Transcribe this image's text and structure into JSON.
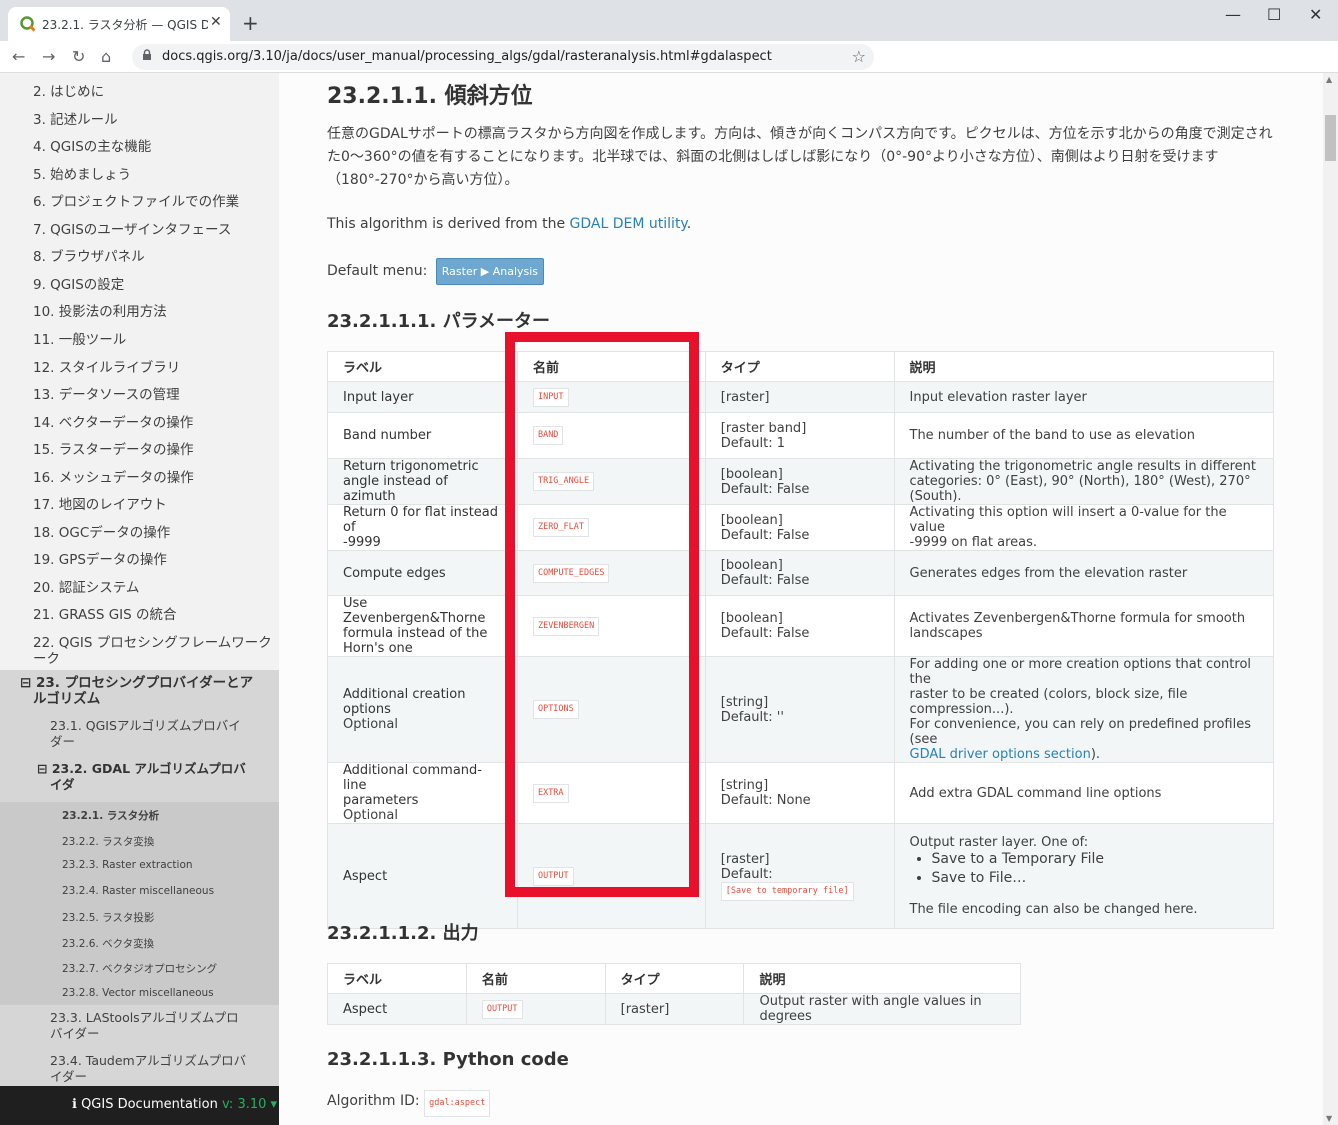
{
  "browser": {
    "tab_title": "23.2.1. ラスタ分析 — QGIS Docum",
    "url": "docs.qgis.org/3.10/ja/docs/user_manual/processing_algs/gdal/rasteranalysis.html#gdalaspect",
    "minimize": "—",
    "maximize": "☐",
    "close": "✕",
    "newtab": "+",
    "tab_close": "✕",
    "back": "←",
    "forward": "→",
    "reload": "↻",
    "home": "⌂",
    "lock": "🔒",
    "star": "☆"
  },
  "sidebar": {
    "items": [
      "2. はじめに",
      "3. 記述ルール",
      "4. QGISの主な機能",
      "5. 始めましょう",
      "6. プロジェクトファイルでの作業",
      "7. QGISのユーザインタフェース",
      "8. ブラウザパネル",
      "9. QGISの設定",
      "10. 投影法の利用方法",
      "11. 一般ツール",
      "12. スタイルライブラリ",
      "13. データソースの管理",
      "14. ベクターデータの操作",
      "15. ラスターデータの操作",
      "16. メッシュデータの操作",
      "17. 地図のレイアウト",
      "18. OGCデータの操作",
      "19. GPSデータの操作",
      "20. 認証システム",
      "21. GRASS GIS の統合",
      "22. QGIS プロセシングフレームワーク"
    ],
    "item22_line2": "ーク",
    "section23_line1": "⊟ 23. プロセシングプロバイダーとア",
    "section23_line2": "ルゴリズム",
    "item231_line1": "23.1. QGISアルゴリズムプロバイ",
    "item231_line2": "ダー",
    "item232_line1": "⊟ 23.2. GDAL アルゴリズムプロバ",
    "item232_line2": "イダ",
    "sub_items": [
      "23.2.1. ラスタ分析",
      "23.2.2. ラスタ変換",
      "23.2.3. Raster extraction",
      "23.2.4. Raster miscellaneous",
      "23.2.5. ラスタ投影",
      "23.2.6. ベクタ変換",
      "23.2.7. ベクタジオプロセシング",
      "23.2.8. Vector miscellaneous"
    ],
    "item233_line1": "23.3. LAStoolsアルゴリズムプロ",
    "item233_line2": "バイダー",
    "item234_line1": "23.4. Taudemアルゴリズムプロバ",
    "item234_line2": "イダー",
    "footer_label": "ℹ QGIS Documentation",
    "footer_version": " v: 3.10 ▾"
  },
  "content": {
    "title": "23.2.1.1. 傾斜方位",
    "description": "任意のGDALサポートの標高ラスタから方向図を作成します。方向は、傾きが向くコンパス方向です。ピクセルは、方位を示す北からの角度で測定された0〜360°の値を有することになります。北半球では、斜面の北側はしばしば影になり（0°-90°より小さな方位）、南側はより日射を受けます（180°-270°から高い方位）。",
    "derived_prefix": "This algorithm is derived from the ",
    "derived_link": "GDAL DEM utility",
    "derived_suffix": ".",
    "default_menu_label": "Default menu:",
    "default_menu_value": "Raster ▶ Analysis",
    "params_heading": "23.2.1.1.1. パラメーター",
    "params_headers": [
      "ラベル",
      "名前",
      "タイプ",
      "説明"
    ],
    "params_rows": [
      {
        "label": "Input layer",
        "name": "INPUT",
        "type": "[raster]",
        "desc": "Input elevation raster layer"
      },
      {
        "label": "Band number",
        "name": "BAND",
        "type": "[raster band]\nDefault: 1",
        "desc": "The number of the band to use as elevation"
      },
      {
        "label": "Return trigonometric\nangle instead of azimuth",
        "name": "TRIG_ANGLE",
        "type": "[boolean]\nDefault: False",
        "desc": "Activating the trigonometric angle results in different\ncategories: 0° (East), 90° (North), 180° (West), 270° (South)."
      },
      {
        "label": "Return 0 for flat instead of\n-9999",
        "name": "ZERO_FLAT",
        "type": "[boolean]\nDefault: False",
        "desc": "Activating this option will insert a 0-value for the value\n-9999 on flat areas."
      },
      {
        "label": "Compute edges",
        "name": "COMPUTE_EDGES",
        "type": "[boolean]\nDefault: False",
        "desc": "Generates edges from the elevation raster"
      },
      {
        "label": "Use Zevenbergen&Thorne\nformula instead of the\nHorn's one",
        "name": "ZEVENBERGEN",
        "type": "[boolean]\nDefault: False",
        "desc": "Activates Zevenbergen&Thorne formula for smooth\nlandscapes"
      },
      {
        "label": "Additional creation\noptions",
        "label_extra": "Optional",
        "name": "OPTIONS",
        "type": "[string]\nDefault: ''",
        "desc": "For adding one or more creation options that control the\nraster to be created (colors, block size, file compression...).\nFor convenience, you can rely on predefined profiles (see",
        "desc_link": "GDAL driver options section",
        "desc_after": ")."
      },
      {
        "label": "Additional command-line\nparameters",
        "label_extra": "Optional",
        "name": "EXTRA",
        "type": "[string]\nDefault: None",
        "desc": "Add extra GDAL command line options"
      }
    ],
    "aspect_row": {
      "label": "Aspect",
      "name": "OUTPUT",
      "type": "[raster]\nDefault:",
      "type_code": "[Save to temporary file]",
      "desc_intro": "Output raster layer. One of:",
      "desc_opts": [
        "Save to a Temporary File",
        "Save to File…"
      ],
      "desc_outro": "The file encoding can also be changed here."
    },
    "outputs_heading": "23.2.1.1.2. 出力",
    "outputs_headers": [
      "ラベル",
      "名前",
      "タイプ",
      "説明"
    ],
    "outputs_row": {
      "label": "Aspect",
      "name": "OUTPUT",
      "type": "[raster]",
      "desc": "Output raster with angle values in degrees"
    },
    "python_heading": "23.2.1.1.3. Python code",
    "algorithm_id_label": "Algorithm ID:",
    "algorithm_id": "gdal:aspect"
  },
  "colors": {
    "highlight_box": "#e8102a",
    "link": "#2980b9",
    "code_text": "#e74c3c",
    "footer_version": "#27ae60"
  }
}
